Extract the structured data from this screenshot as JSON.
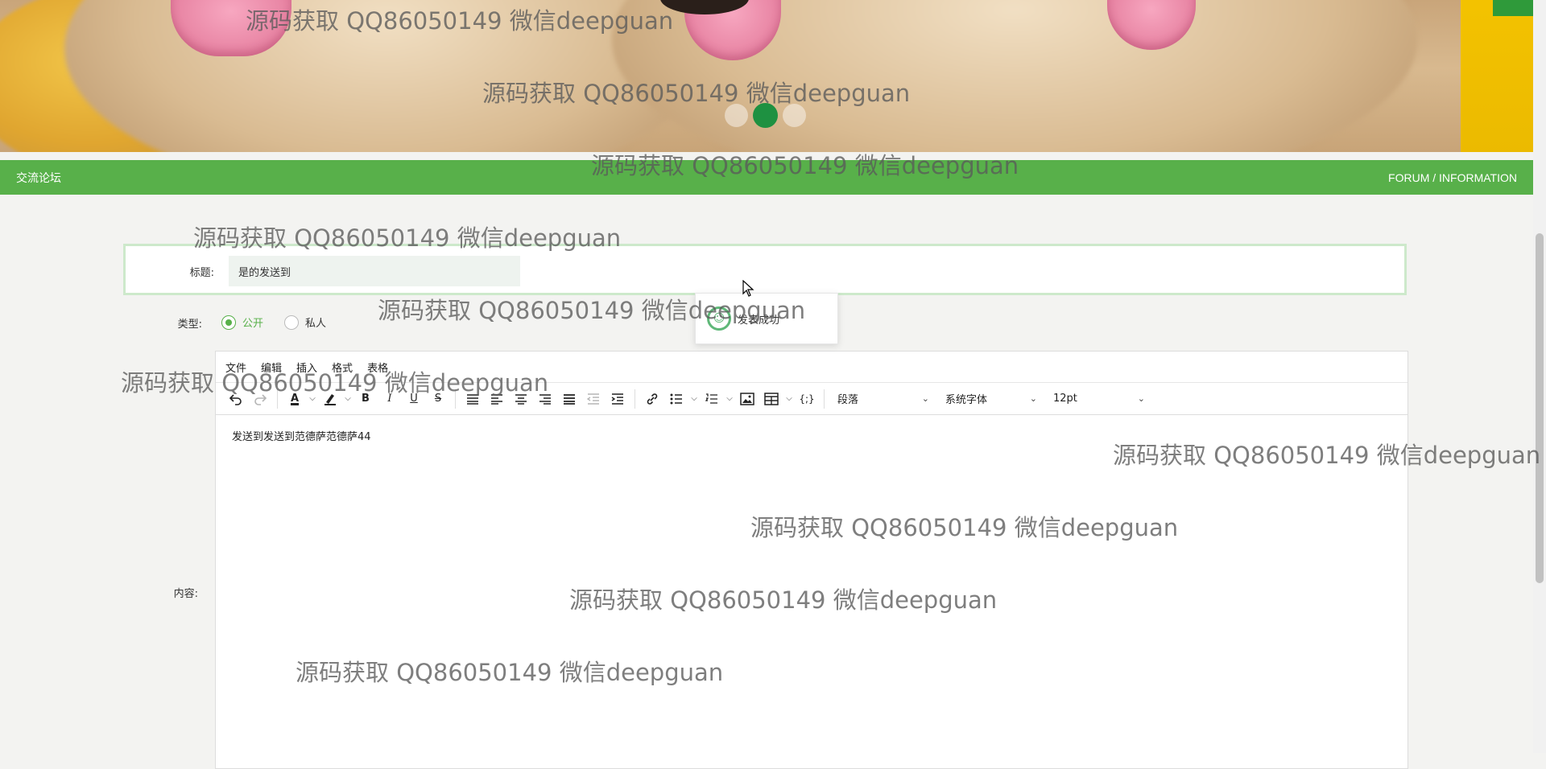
{
  "header": {
    "section_title": "交流论坛",
    "section_subtitle": "FORUM / INFORMATION"
  },
  "form": {
    "title_label": "标题:",
    "title_value": "是的发送到",
    "type_label": "类型:",
    "type_options": [
      {
        "label": "公开",
        "checked": true
      },
      {
        "label": "私人",
        "checked": false
      }
    ],
    "content_label": "内容:"
  },
  "editor": {
    "menu": [
      "文件",
      "编辑",
      "插入",
      "格式",
      "表格"
    ],
    "block_format": "段落",
    "font_family": "系统字体",
    "font_size": "12pt",
    "content_text": "发送到发送到范德萨范德萨44"
  },
  "toast": {
    "message": "发表成功"
  },
  "watermark_text": "源码获取 QQ86050149 微信deepguan",
  "colors": {
    "brand_green": "#58b04a",
    "active_dot": "#1e9141",
    "toast_icon": "#5fb878"
  },
  "carousel": {
    "slide_count": 3,
    "active_index": 1
  }
}
